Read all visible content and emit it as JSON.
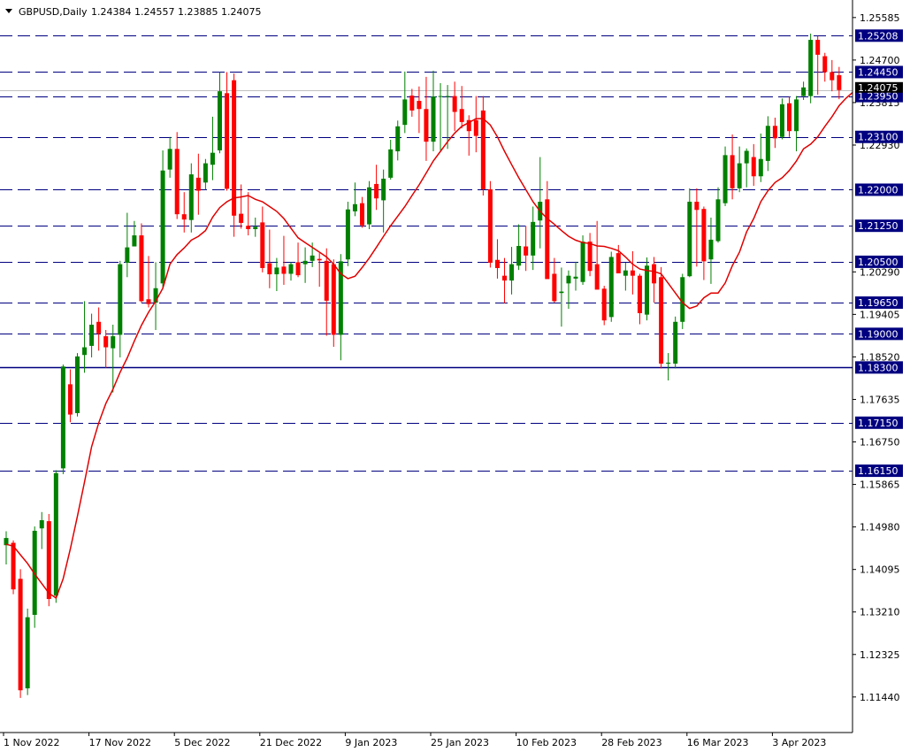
{
  "header": {
    "symbol": "GBPUSD,Daily",
    "ohlc": "1.24384 1.24557 1.23885 1.24075"
  },
  "chart_data": {
    "type": "candlestick",
    "symbol": "GBPUSD",
    "timeframe": "Daily",
    "current_price": "1.24075",
    "ylim": [
      1.107,
      1.2595
    ],
    "y_ticks": [
      "1.25585",
      "1.24700",
      "1.23815",
      "1.22930",
      "1.20290",
      "1.19405",
      "1.18520",
      "1.17635",
      "1.16750",
      "1.15865",
      "1.14980",
      "1.14095",
      "1.13210",
      "1.12325",
      "1.11440"
    ],
    "x_labels": [
      {
        "label": "1 Nov 2022",
        "index": 0
      },
      {
        "label": "17 Nov 2022",
        "index": 12
      },
      {
        "label": "5 Dec 2022",
        "index": 24
      },
      {
        "label": "21 Dec 2022",
        "index": 36
      },
      {
        "label": "9 Jan 2023",
        "index": 48
      },
      {
        "label": "25 Jan 2023",
        "index": 60
      },
      {
        "label": "10 Feb 2023",
        "index": 72
      },
      {
        "label": "28 Feb 2023",
        "index": 84
      },
      {
        "label": "16 Mar 2023",
        "index": 96
      },
      {
        "label": "3 Apr 2023",
        "index": 108
      }
    ],
    "levels": [
      {
        "value": 1.25208,
        "label": "1.25208",
        "style": "dashed"
      },
      {
        "value": 1.2445,
        "label": "1.24450",
        "style": "dashed"
      },
      {
        "value": 1.2395,
        "label": "1.23950",
        "style": "dashed"
      },
      {
        "value": 1.231,
        "label": "1.23100",
        "style": "dashed"
      },
      {
        "value": 1.22,
        "label": "1.22000",
        "style": "dashed"
      },
      {
        "value": 1.2125,
        "label": "1.21250",
        "style": "dashed"
      },
      {
        "value": 1.205,
        "label": "1.20500",
        "style": "dashed"
      },
      {
        "value": 1.1965,
        "label": "1.19650",
        "style": "dashed"
      },
      {
        "value": 1.19,
        "label": "1.19000",
        "style": "dashed"
      },
      {
        "value": 1.183,
        "label": "1.18300",
        "style": "solid"
      },
      {
        "value": 1.1715,
        "label": "1.17150",
        "style": "dashed"
      },
      {
        "value": 1.1615,
        "label": "1.16150",
        "style": "dashed"
      }
    ],
    "colors": {
      "bull": "#008000",
      "bear": "#ff0000",
      "ma": "#e00000",
      "level_line": "#000080",
      "level_label_bg": "#000080",
      "price_label_bg": "#000000"
    },
    "candles": [
      {
        "o": 1.146,
        "h": 1.1489,
        "l": 1.142,
        "c": 1.1475
      },
      {
        "o": 1.1465,
        "h": 1.147,
        "l": 1.1358,
        "c": 1.1368
      },
      {
        "o": 1.139,
        "h": 1.141,
        "l": 1.1142,
        "c": 1.1158
      },
      {
        "o": 1.1162,
        "h": 1.1328,
        "l": 1.1148,
        "c": 1.131
      },
      {
        "o": 1.1315,
        "h": 1.1499,
        "l": 1.1288,
        "c": 1.149
      },
      {
        "o": 1.1495,
        "h": 1.1529,
        "l": 1.1452,
        "c": 1.1512
      },
      {
        "o": 1.151,
        "h": 1.1525,
        "l": 1.1333,
        "c": 1.1348
      },
      {
        "o": 1.1355,
        "h": 1.1616,
        "l": 1.134,
        "c": 1.161
      },
      {
        "o": 1.162,
        "h": 1.1836,
        "l": 1.1608,
        "c": 1.1832
      },
      {
        "o": 1.1795,
        "h": 1.1826,
        "l": 1.1716,
        "c": 1.1732
      },
      {
        "o": 1.1735,
        "h": 1.186,
        "l": 1.1728,
        "c": 1.1853
      },
      {
        "o": 1.1856,
        "h": 1.1968,
        "l": 1.1819,
        "c": 1.1872
      },
      {
        "o": 1.1875,
        "h": 1.1942,
        "l": 1.1851,
        "c": 1.1919
      },
      {
        "o": 1.1925,
        "h": 1.1955,
        "l": 1.1865,
        "c": 1.1901
      },
      {
        "o": 1.1895,
        "h": 1.1908,
        "l": 1.1829,
        "c": 1.1872
      },
      {
        "o": 1.187,
        "h": 1.1919,
        "l": 1.1778,
        "c": 1.1895
      },
      {
        "o": 1.1898,
        "h": 1.2052,
        "l": 1.1851,
        "c": 1.2045
      },
      {
        "o": 1.2048,
        "h": 1.2152,
        "l": 1.2018,
        "c": 1.208
      },
      {
        "o": 1.2082,
        "h": 1.2135,
        "l": 1.2082,
        "c": 1.2105
      },
      {
        "o": 1.2105,
        "h": 1.213,
        "l": 1.1965,
        "c": 1.1968
      },
      {
        "o": 1.1972,
        "h": 1.2062,
        "l": 1.1955,
        "c": 1.1962
      },
      {
        "o": 1.1965,
        "h": 1.2049,
        "l": 1.1908,
        "c": 1.1995
      },
      {
        "o": 1.2005,
        "h": 1.2282,
        "l": 1.1995,
        "c": 1.224
      },
      {
        "o": 1.2242,
        "h": 1.231,
        "l": 1.2225,
        "c": 1.2285
      },
      {
        "o": 1.2285,
        "h": 1.232,
        "l": 1.2139,
        "c": 1.2149
      },
      {
        "o": 1.2149,
        "h": 1.2195,
        "l": 1.2111,
        "c": 1.2138
      },
      {
        "o": 1.2137,
        "h": 1.2255,
        "l": 1.2111,
        "c": 1.2232
      },
      {
        "o": 1.2225,
        "h": 1.2275,
        "l": 1.2148,
        "c": 1.2198
      },
      {
        "o": 1.2215,
        "h": 1.2264,
        "l": 1.22,
        "c": 1.2255
      },
      {
        "o": 1.2252,
        "h": 1.2352,
        "l": 1.222,
        "c": 1.2277
      },
      {
        "o": 1.2282,
        "h": 1.2445,
        "l": 1.2276,
        "c": 1.2405
      },
      {
        "o": 1.2401,
        "h": 1.2445,
        "l": 1.2198,
        "c": 1.2202
      },
      {
        "o": 1.2428,
        "h": 1.2442,
        "l": 1.2102,
        "c": 1.2146
      },
      {
        "o": 1.215,
        "h": 1.2211,
        "l": 1.2119,
        "c": 1.2131
      },
      {
        "o": 1.2125,
        "h": 1.2195,
        "l": 1.2105,
        "c": 1.2118
      },
      {
        "o": 1.2118,
        "h": 1.2142,
        "l": 1.2102,
        "c": 1.2123
      },
      {
        "o": 1.2132,
        "h": 1.2165,
        "l": 1.2028,
        "c": 1.2037
      },
      {
        "o": 1.2047,
        "h": 1.2117,
        "l": 1.1995,
        "c": 1.2024
      },
      {
        "o": 1.2024,
        "h": 1.2058,
        "l": 1.1989,
        "c": 1.2038
      },
      {
        "o": 1.204,
        "h": 1.2104,
        "l": 1.2002,
        "c": 1.2025
      },
      {
        "o": 1.2025,
        "h": 1.2049,
        "l": 1.2011,
        "c": 1.2045
      },
      {
        "o": 1.2049,
        "h": 1.209,
        "l": 1.2018,
        "c": 1.2022
      },
      {
        "o": 1.2045,
        "h": 1.208,
        "l": 1.2006,
        "c": 1.2052
      },
      {
        "o": 1.2052,
        "h": 1.209,
        "l": 1.2039,
        "c": 1.2063
      },
      {
        "o": 1.2056,
        "h": 1.2068,
        "l": 1.1998,
        "c": 1.2053
      },
      {
        "o": 1.2052,
        "h": 1.2078,
        "l": 1.1896,
        "c": 1.1969
      },
      {
        "o": 1.2045,
        "h": 1.2055,
        "l": 1.1873,
        "c": 1.1898
      },
      {
        "o": 1.1898,
        "h": 1.2066,
        "l": 1.1845,
        "c": 1.2051
      },
      {
        "o": 1.2055,
        "h": 1.2175,
        "l": 1.2041,
        "c": 1.2159
      },
      {
        "o": 1.2155,
        "h": 1.2215,
        "l": 1.2145,
        "c": 1.217
      },
      {
        "o": 1.2172,
        "h": 1.2185,
        "l": 1.2121,
        "c": 1.2126
      },
      {
        "o": 1.2128,
        "h": 1.2218,
        "l": 1.2118,
        "c": 1.2205
      },
      {
        "o": 1.2212,
        "h": 1.2252,
        "l": 1.2158,
        "c": 1.2182
      },
      {
        "o": 1.2178,
        "h": 1.2242,
        "l": 1.2111,
        "c": 1.2223
      },
      {
        "o": 1.2225,
        "h": 1.2304,
        "l": 1.2221,
        "c": 1.2284
      },
      {
        "o": 1.228,
        "h": 1.2344,
        "l": 1.2261,
        "c": 1.2332
      },
      {
        "o": 1.2335,
        "h": 1.2446,
        "l": 1.2318,
        "c": 1.2388
      },
      {
        "o": 1.2396,
        "h": 1.241,
        "l": 1.2352,
        "c": 1.2365
      },
      {
        "o": 1.2385,
        "h": 1.2415,
        "l": 1.2318,
        "c": 1.2368
      },
      {
        "o": 1.2368,
        "h": 1.2435,
        "l": 1.226,
        "c": 1.23
      },
      {
        "o": 1.23,
        "h": 1.2448,
        "l": 1.228,
        "c": 1.2394
      },
      {
        "o": 1.2394,
        "h": 1.2422,
        "l": 1.2282,
        "c": 1.2395
      },
      {
        "o": 1.2395,
        "h": 1.2418,
        "l": 1.2285,
        "c": 1.2395
      },
      {
        "o": 1.2395,
        "h": 1.2425,
        "l": 1.2322,
        "c": 1.2362
      },
      {
        "o": 1.2368,
        "h": 1.2416,
        "l": 1.2328,
        "c": 1.2341
      },
      {
        "o": 1.2345,
        "h": 1.2355,
        "l": 1.2271,
        "c": 1.2322
      },
      {
        "o": 1.2345,
        "h": 1.2395,
        "l": 1.2278,
        "c": 1.2312
      },
      {
        "o": 1.2365,
        "h": 1.2395,
        "l": 1.2188,
        "c": 1.2201
      },
      {
        "o": 1.2201,
        "h": 1.2218,
        "l": 1.2038,
        "c": 1.2048
      },
      {
        "o": 1.2054,
        "h": 1.2097,
        "l": 1.2015,
        "c": 1.2037
      },
      {
        "o": 1.2021,
        "h": 1.2058,
        "l": 1.1964,
        "c": 1.2011
      },
      {
        "o": 1.2011,
        "h": 1.2081,
        "l": 1.1982,
        "c": 1.2045
      },
      {
        "o": 1.2042,
        "h": 1.2128,
        "l": 1.2033,
        "c": 1.2083
      },
      {
        "o": 1.2082,
        "h": 1.2125,
        "l": 1.2031,
        "c": 1.2063
      },
      {
        "o": 1.2063,
        "h": 1.2165,
        "l": 1.2033,
        "c": 1.2133
      },
      {
        "o": 1.2136,
        "h": 1.2268,
        "l": 1.2078,
        "c": 1.2175
      },
      {
        "o": 1.218,
        "h": 1.2218,
        "l": 1.2031,
        "c": 1.2014
      },
      {
        "o": 1.2025,
        "h": 1.2058,
        "l": 1.1965,
        "c": 1.1968
      },
      {
        "o": 1.1985,
        "h": 1.2038,
        "l": 1.1915,
        "c": 1.1988
      },
      {
        "o": 1.2005,
        "h": 1.2032,
        "l": 1.1952,
        "c": 1.2021
      },
      {
        "o": 1.2015,
        "h": 1.205,
        "l": 1.199,
        "c": 1.2019
      },
      {
        "o": 1.2008,
        "h": 1.2105,
        "l": 1.2002,
        "c": 1.2092
      },
      {
        "o": 1.2092,
        "h": 1.211,
        "l": 1.202,
        "c": 1.2031
      },
      {
        "o": 1.2045,
        "h": 1.2135,
        "l": 1.2018,
        "c": 1.1992
      },
      {
        "o": 1.1994,
        "h": 1.2,
        "l": 1.1918,
        "c": 1.1928
      },
      {
        "o": 1.1935,
        "h": 1.2071,
        "l": 1.1925,
        "c": 1.206
      },
      {
        "o": 1.2068,
        "h": 1.2085,
        "l": 1.2033,
        "c": 1.2026
      },
      {
        "o": 1.2021,
        "h": 1.2048,
        "l": 1.199,
        "c": 1.2032
      },
      {
        "o": 1.2032,
        "h": 1.2072,
        "l": 1.1982,
        "c": 1.2021
      },
      {
        "o": 1.2021,
        "h": 1.2025,
        "l": 1.192,
        "c": 1.1943
      },
      {
        "o": 1.194,
        "h": 1.2059,
        "l": 1.1928,
        "c": 1.2042
      },
      {
        "o": 1.2045,
        "h": 1.206,
        "l": 1.1965,
        "c": 1.2005
      },
      {
        "o": 1.2018,
        "h": 1.2039,
        "l": 1.1828,
        "c": 1.1838
      },
      {
        "o": 1.1838,
        "h": 1.186,
        "l": 1.1803,
        "c": 1.184
      },
      {
        "o": 1.1838,
        "h": 1.1936,
        "l": 1.1828,
        "c": 1.1925
      },
      {
        "o": 1.1925,
        "h": 1.2025,
        "l": 1.191,
        "c": 1.2018
      },
      {
        "o": 1.202,
        "h": 1.2203,
        "l": 1.2018,
        "c": 1.2175
      },
      {
        "o": 1.2175,
        "h": 1.2203,
        "l": 1.204,
        "c": 1.2158
      },
      {
        "o": 1.216,
        "h": 1.2165,
        "l": 1.2012,
        "c": 1.2051
      },
      {
        "o": 1.2055,
        "h": 1.2142,
        "l": 1.2004,
        "c": 1.2096
      },
      {
        "o": 1.2093,
        "h": 1.2205,
        "l": 1.209,
        "c": 1.218
      },
      {
        "o": 1.2172,
        "h": 1.229,
        "l": 1.2166,
        "c": 1.2272
      },
      {
        "o": 1.2272,
        "h": 1.2315,
        "l": 1.218,
        "c": 1.2203
      },
      {
        "o": 1.2203,
        "h": 1.229,
        "l": 1.2195,
        "c": 1.2255
      },
      {
        "o": 1.2255,
        "h": 1.2286,
        "l": 1.2205,
        "c": 1.2281
      },
      {
        "o": 1.2268,
        "h": 1.2295,
        "l": 1.2208,
        "c": 1.2228
      },
      {
        "o": 1.2228,
        "h": 1.2317,
        "l": 1.2216,
        "c": 1.2264
      },
      {
        "o": 1.226,
        "h": 1.2353,
        "l": 1.2239,
        "c": 1.2333
      },
      {
        "o": 1.2333,
        "h": 1.235,
        "l": 1.2287,
        "c": 1.2307
      },
      {
        "o": 1.231,
        "h": 1.239,
        "l": 1.2305,
        "c": 1.2378
      },
      {
        "o": 1.238,
        "h": 1.2394,
        "l": 1.231,
        "c": 1.2322
      },
      {
        "o": 1.2322,
        "h": 1.2395,
        "l": 1.228,
        "c": 1.2388
      },
      {
        "o": 1.2395,
        "h": 1.2425,
        "l": 1.2387,
        "c": 1.2413
      },
      {
        "o": 1.2395,
        "h": 1.2525,
        "l": 1.238,
        "c": 1.2512
      },
      {
        "o": 1.2512,
        "h": 1.252,
        "l": 1.2398,
        "c": 1.2481
      },
      {
        "o": 1.2478,
        "h": 1.2485,
        "l": 1.2425,
        "c": 1.2445
      },
      {
        "o": 1.2445,
        "h": 1.247,
        "l": 1.2405,
        "c": 1.2428
      },
      {
        "o": 1.24384,
        "h": 1.24557,
        "l": 1.23885,
        "c": 1.24075
      }
    ],
    "ma": [
      1.1462,
      1.1458,
      1.144,
      1.1422,
      1.14,
      1.138,
      1.136,
      1.135,
      1.139,
      1.1452,
      1.152,
      1.1592,
      1.1665,
      1.1715,
      1.1755,
      1.1785,
      1.182,
      1.185,
      1.1885,
      1.1918,
      1.1945,
      1.1968,
      1.1995,
      1.2045,
      1.2065,
      1.2079,
      1.2095,
      1.2103,
      1.2115,
      1.2143,
      1.2163,
      1.2175,
      1.2183,
      1.2185,
      1.2188,
      1.218,
      1.2175,
      1.2165,
      1.2155,
      1.214,
      1.212,
      1.21,
      1.209,
      1.208,
      1.207,
      1.206,
      1.2045,
      1.2025,
      1.2015,
      1.202,
      1.2038,
      1.2058,
      1.208,
      1.2103,
      1.2125,
      1.2145,
      1.2165,
      1.2188,
      1.221,
      1.2235,
      1.226,
      1.228,
      1.23,
      1.2318,
      1.2332,
      1.234,
      1.2348,
      1.2348,
      1.2335,
      1.231,
      1.228,
      1.2252,
      1.2225,
      1.22,
      1.2175,
      1.2155,
      1.214,
      1.2128,
      1.2115,
      1.2103,
      1.2095,
      1.209,
      1.2088,
      1.2083,
      1.2082,
      1.2078,
      1.2073,
      1.206,
      1.2045,
      1.2035,
      1.2032,
      1.203,
      1.2025,
      1.2005,
      1.1985,
      1.1965,
      1.1953,
      1.1958,
      1.1975,
      1.1985,
      1.1985,
      1.2006,
      1.2042,
      1.207,
      1.2112,
      1.214,
      1.2175,
      1.2198,
      1.2215,
      1.2225,
      1.224,
      1.226,
      1.2285,
      1.2295,
      1.231,
      1.2332,
      1.2352,
      1.2375,
      1.2391,
      1.2404
    ]
  }
}
